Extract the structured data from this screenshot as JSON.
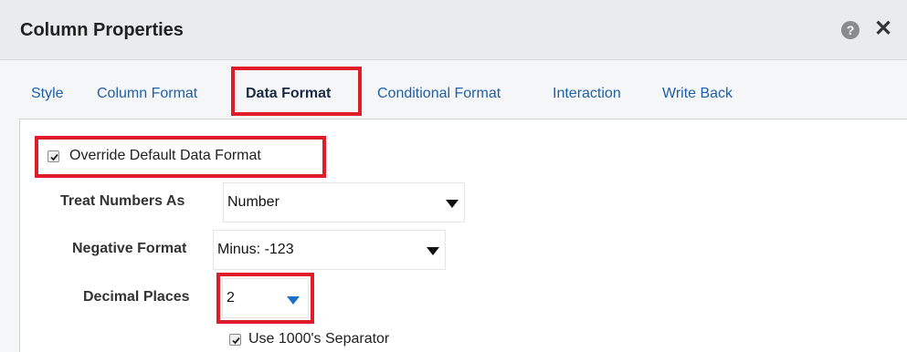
{
  "dialog": {
    "title": "Column Properties",
    "help_icon": "?",
    "close_icon": "✕"
  },
  "tabs": [
    {
      "label": "Style"
    },
    {
      "label": "Column Format"
    },
    {
      "label": "Data Format",
      "active": true
    },
    {
      "label": "Conditional Format"
    },
    {
      "label": "Interaction"
    },
    {
      "label": "Write Back"
    }
  ],
  "form": {
    "override": {
      "label": "Override Default Data Format",
      "checked": true
    },
    "treat_numbers_as": {
      "label": "Treat Numbers As",
      "value": "Number"
    },
    "negative_format": {
      "label": "Negative Format",
      "value": "Minus: -123"
    },
    "decimal_places": {
      "label": "Decimal Places",
      "value": "2"
    },
    "separator": {
      "label": "Use 1000's Separator",
      "checked": true
    }
  },
  "colors": {
    "link": "#1f5fa8",
    "highlight": "#e01b2a",
    "decimal_caret": "#1a73c9"
  }
}
